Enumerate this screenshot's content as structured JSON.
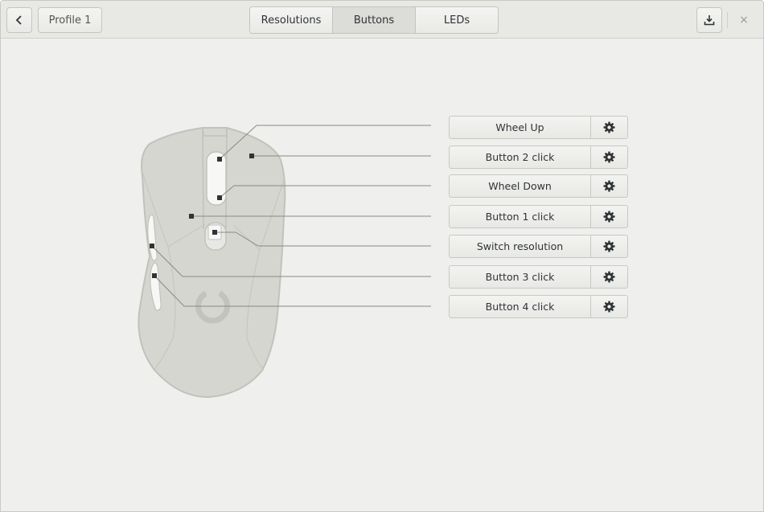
{
  "header": {
    "back_icon": "go-previous-icon",
    "profile_label": "Profile 1",
    "tabs": [
      {
        "label": "Resolutions",
        "active": false
      },
      {
        "label": "Buttons",
        "active": true
      },
      {
        "label": "LEDs",
        "active": false
      }
    ],
    "commit_icon": "download-icon",
    "close_icon": "×"
  },
  "buttons": [
    {
      "label": "Wheel Up"
    },
    {
      "label": "Button 2 click"
    },
    {
      "label": "Wheel Down"
    },
    {
      "label": "Button 1 click"
    },
    {
      "label": "Switch resolution"
    },
    {
      "label": "Button 3 click"
    },
    {
      "label": "Button 4 click"
    }
  ],
  "colors": {
    "background": "#efefed",
    "mouse_body": "#d6d6d0",
    "mouse_outline": "#c2c2bc",
    "leader_line": "#8a8a86",
    "marker": "#2e3436"
  }
}
